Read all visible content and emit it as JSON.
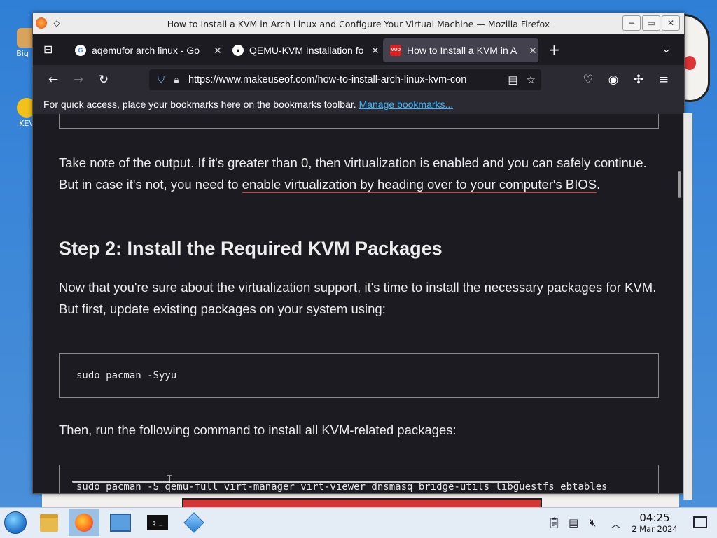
{
  "window": {
    "title": "How to Install a KVM in Arch Linux and Configure Your Virtual Machine — Mozilla Firefox"
  },
  "tabs": [
    {
      "label": "aqemufor arch linux - Go",
      "favicon": "google-icon",
      "active": false
    },
    {
      "label": "QEMU-KVM Installation fo",
      "favicon": "github-icon",
      "active": false
    },
    {
      "label": "How to Install a KVM in A",
      "favicon": "makeuseof-icon",
      "favicon_text": "MUO",
      "active": true
    }
  ],
  "nav": {
    "url": "https://www.makeuseof.com/how-to-install-arch-linux-kvm-con"
  },
  "bookmarks_bar": {
    "text": "For quick access, place your bookmarks here on the bookmarks toolbar.",
    "link": "Manage bookmarks..."
  },
  "article": {
    "para1_start": "Take note of the output. If it's greater than 0, then virtualization is enabled and you can safely continue. But in case it's not, you need to ",
    "para1_link": "enable virtualization by heading over to your computer's BIOS",
    "para1_end": ".",
    "heading": "Step 2: Install the Required KVM Packages",
    "para2": "Now that you're sure about the virtualization support, it's time to install the necessary packages for KVM. But first, update existing packages on your system using:",
    "code1": "sudo pacman -Syyu",
    "para3": "Then, run the following command to install all KVM-related packages:",
    "code2": "sudo pacman -S qemu-full virt-manager virt-viewer dnsmasq bridge-utils libguestfs ebtables"
  },
  "taskbar": {
    "term_label": "$ _",
    "time": "04:25",
    "date": "2 Mar 2024"
  },
  "desktop": {
    "icon1_label": "Big D",
    "icon2_label": "KEV"
  },
  "colors": {
    "accent_link": "#39b8ff",
    "link_underline": "#e0392e",
    "page_bg": "#1c1b22"
  }
}
